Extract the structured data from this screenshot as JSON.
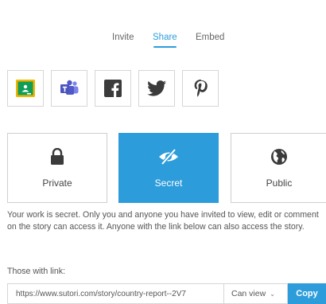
{
  "tabs": [
    {
      "label": "Invite",
      "active": false
    },
    {
      "label": "Share",
      "active": true
    },
    {
      "label": "Embed",
      "active": false
    }
  ],
  "share_targets": [
    {
      "name": "google-classroom",
      "icon": "google-classroom-icon",
      "color": "#0f9d58"
    },
    {
      "name": "microsoft-teams",
      "icon": "microsoft-teams-icon",
      "color": "#5059c9"
    },
    {
      "name": "facebook",
      "icon": "facebook-icon",
      "color": "#3b3b3b"
    },
    {
      "name": "twitter",
      "icon": "twitter-icon",
      "color": "#3b3b3b"
    },
    {
      "name": "pinterest",
      "icon": "pinterest-icon",
      "color": "#3b3b3b"
    }
  ],
  "privacy_options": [
    {
      "label": "Private",
      "icon": "lock-icon",
      "selected": false
    },
    {
      "label": "Secret",
      "icon": "eye-slash-icon",
      "selected": true
    },
    {
      "label": "Public",
      "icon": "globe-icon",
      "selected": false
    }
  ],
  "description": "Your work is secret. Only you and anyone you have invited to view, edit or comment on the story can access it. Anyone with the link below can also access the story.",
  "link_section": {
    "label": "Those with link:",
    "url": "https://www.sutori.com/story/country-report--2V7",
    "permission": "Can view",
    "copy_label": "Copy"
  },
  "colors": {
    "accent": "#2d9cdb",
    "border": "#d6d6d6",
    "text": "#555555"
  }
}
